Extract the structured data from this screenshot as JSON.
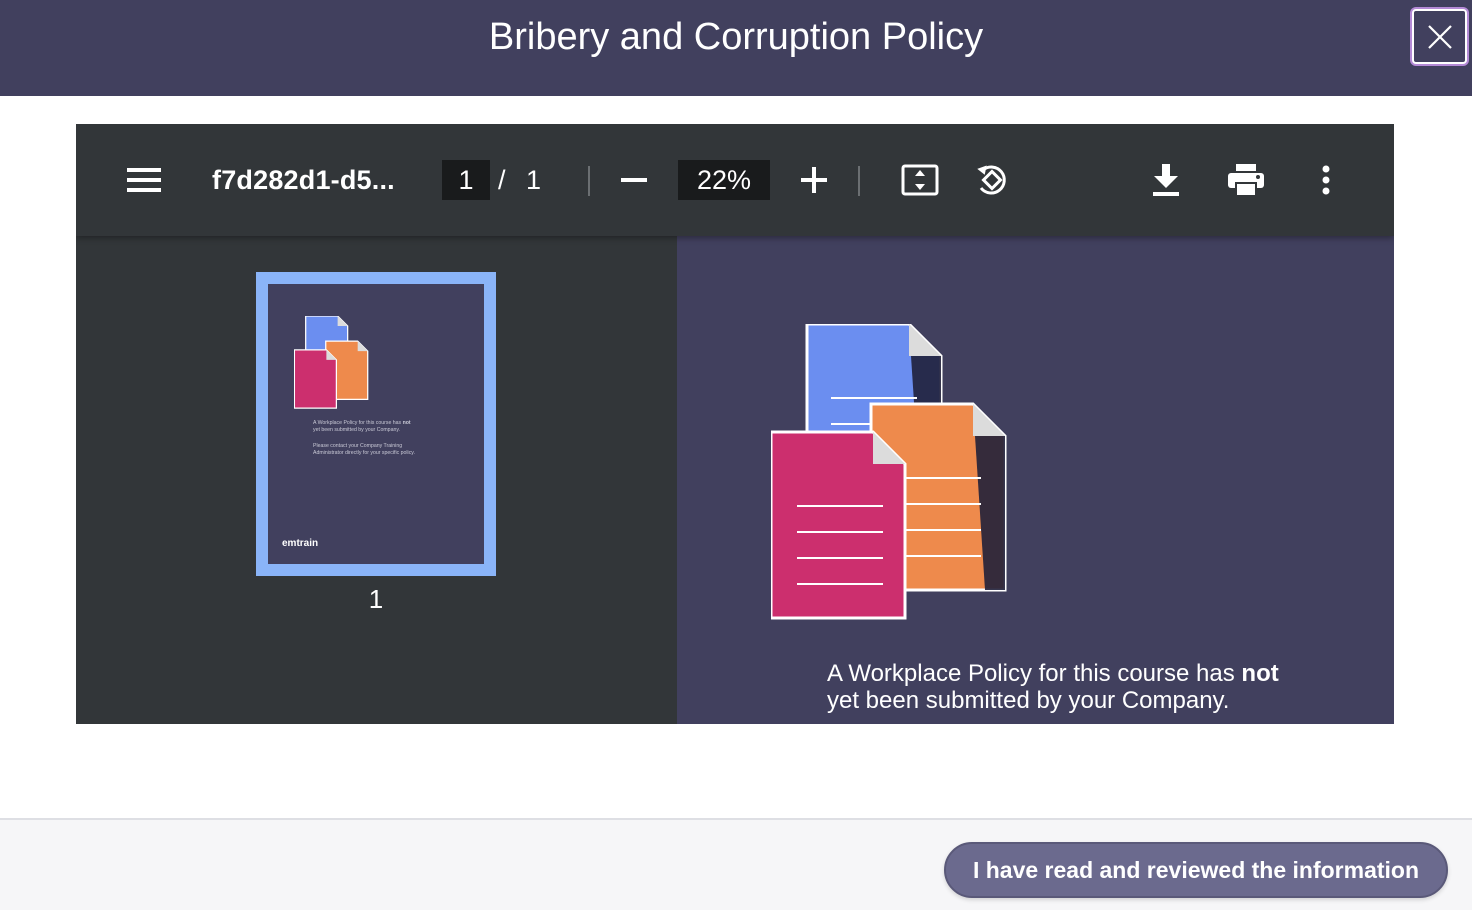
{
  "modal": {
    "title": "Bribery and Corruption Policy",
    "close_icon": "close-icon"
  },
  "toolbar": {
    "menu_icon": "hamburger-menu-icon",
    "file_name": "f7d282d1-d5...",
    "current_page": "1",
    "page_separator": "/",
    "total_pages": "1",
    "zoom_out_icon": "minus-icon",
    "zoom_level": "22%",
    "zoom_in_icon": "plus-icon",
    "fit_icon": "fit-to-page-icon",
    "rotate_icon": "rotate-icon",
    "download_icon": "download-icon",
    "print_icon": "print-icon",
    "more_icon": "more-vertical-icon"
  },
  "sidebar": {
    "thumbnail": {
      "line1": "A Workplace Policy for this course has",
      "line1_bold": "not",
      "line2": "yet been submitted by your Company.",
      "line3": "Please contact your Company Training Administrator directly for your specific policy.",
      "brand": "emtrain",
      "page_label": "1"
    }
  },
  "page": {
    "message_start": "A Workplace Policy for this course has ",
    "message_bold": "not",
    "message_end": "yet been submitted by your Company."
  },
  "footer": {
    "acknowledge_label": "I have read and reviewed the information"
  },
  "colors": {
    "header": "#41405e",
    "viewer": "#323639",
    "page": "#41405e",
    "thumbnail_border": "#8ab4f8",
    "button": "#6b6a8e",
    "doc_blue": "#6b8ef0",
    "doc_orange": "#ee8a4c",
    "doc_pink": "#cc2f6e"
  }
}
